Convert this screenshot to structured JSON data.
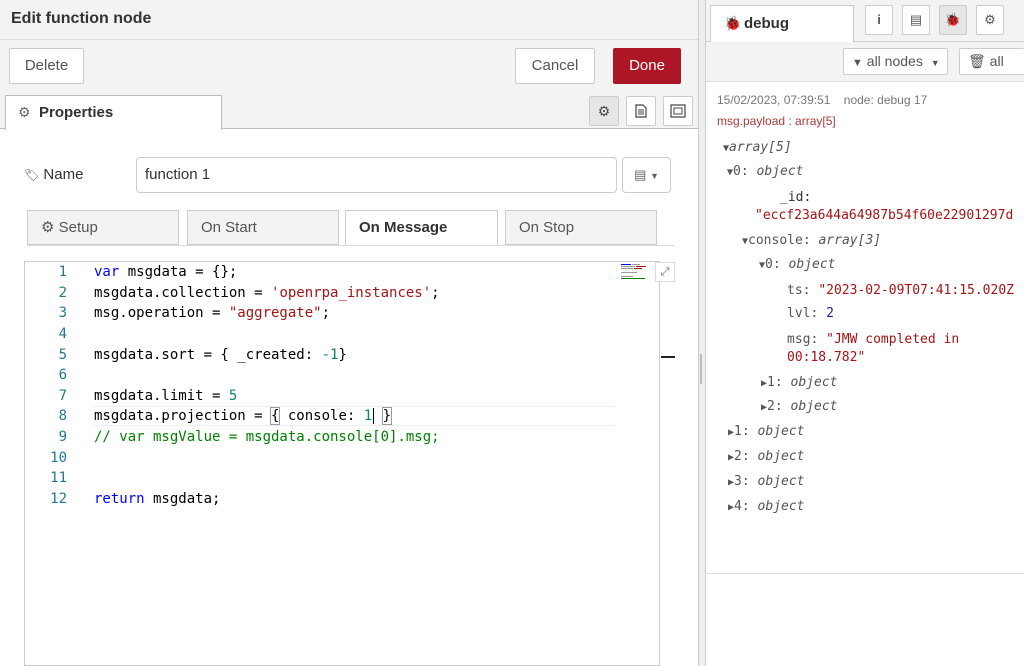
{
  "tray": {
    "title": "Edit function node",
    "delete_label": "Delete",
    "cancel_label": "Cancel",
    "done_label": "Done",
    "properties_tab": "Properties"
  },
  "form": {
    "name_label": "Name",
    "name_value": "function 1"
  },
  "subtabs": [
    "Setup",
    "On Start",
    "On Message",
    "On Stop"
  ],
  "code": {
    "line_numbers": [
      "1",
      "2",
      "3",
      "4",
      "5",
      "6",
      "7",
      "8",
      "9",
      "10",
      "11",
      "12"
    ]
  },
  "sidebar": {
    "tab_label": "debug",
    "filter_label": "all nodes",
    "clear_label": "all",
    "message": {
      "timestamp": "15/02/2023, 07:39:51",
      "node": "node: debug 17",
      "topic": "msg.payload : array[5]",
      "root_type": "array[5]",
      "item0_label": "0:",
      "item0_type": "object",
      "id_key": "_id:",
      "id_value": "\"eccf23a644a64987b54f60e22901297d",
      "console_key": "console:",
      "console_type": "array[3]",
      "c0_label": "0:",
      "c0_type": "object",
      "ts_key": "ts:",
      "ts_value": "\"2023-02-09T07:41:15.020Z",
      "lvl_key": "lvl:",
      "lvl_value": "2",
      "msg_key": "msg:",
      "msg_value_1": "\"JMW completed in",
      "msg_value_2": "00:18.782\"",
      "c1_label": "1:",
      "c1_type": "object",
      "c2_label": "2:",
      "c2_type": "object",
      "items": [
        {
          "label": "1:",
          "type": "object"
        },
        {
          "label": "2:",
          "type": "object"
        },
        {
          "label": "3:",
          "type": "object"
        },
        {
          "label": "4:",
          "type": "object"
        }
      ]
    }
  },
  "colors": {
    "done_button": "#ad1625",
    "keyword": "#0000ff",
    "string": "#a31515",
    "number": "#098658",
    "comment": "#008000"
  }
}
